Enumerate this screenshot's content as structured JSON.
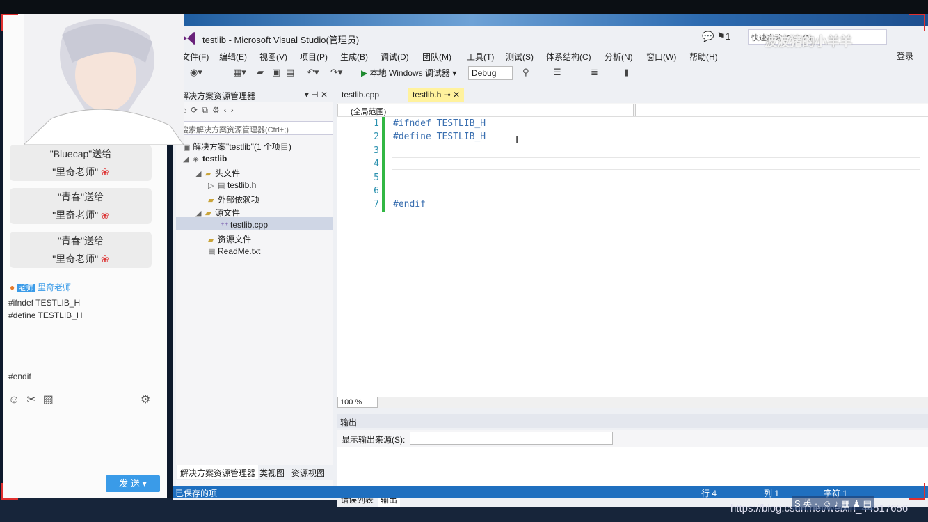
{
  "window": {
    "title": "testlib - Microsoft Visual Studio(管理员)",
    "quick_launch": "快速启动 (Ctrl+Q)",
    "watermark": "波波猪的小羊羊",
    "login": "登录",
    "flag_count": "1"
  },
  "menu": [
    "文件(F)",
    "编辑(E)",
    "视图(V)",
    "项目(P)",
    "生成(B)",
    "调试(D)",
    "团队(M)",
    "工具(T)",
    "测试(S)",
    "体系结构(C)",
    "分析(N)",
    "窗口(W)",
    "帮助(H)"
  ],
  "toolbar": {
    "run_label": "本地 Windows 调试器",
    "config": "Debug"
  },
  "solution_explorer": {
    "title": "解决方案资源管理器",
    "search_placeholder": "搜索解决方案资源管理器(Ctrl+;)",
    "solution": "解决方案\"testlib\"(1 个项目)",
    "project": "testlib",
    "items": {
      "headers": "头文件",
      "header_file": "testlib.h",
      "external": "外部依赖项",
      "sources": "源文件",
      "source_file": "testlib.cpp",
      "resources": "资源文件",
      "readme": "ReadMe.txt"
    },
    "tabs": [
      "解决方案资源管理器",
      "类视图",
      "资源视图"
    ]
  },
  "editor": {
    "tabs": [
      "testlib.cpp",
      "testlib.h"
    ],
    "scope": "(全局范围)",
    "lines": [
      {
        "n": "1",
        "text": "#ifndef TESTLIB_H"
      },
      {
        "n": "2",
        "text": "#define TESTLIB_H"
      },
      {
        "n": "3",
        "text": ""
      },
      {
        "n": "4",
        "text": ""
      },
      {
        "n": "5",
        "text": ""
      },
      {
        "n": "6",
        "text": ""
      },
      {
        "n": "7",
        "text": "#endif"
      }
    ],
    "zoom": "100 %"
  },
  "output": {
    "title": "输出",
    "source_label": "显示输出来源(S):",
    "tabs": [
      "错误列表",
      "输出"
    ]
  },
  "statusbar": {
    "text": "已保存的项",
    "line": "行 4",
    "col": "列 1",
    "char": "字符 1"
  },
  "stream_panel": {
    "gifts": [
      {
        "line1": "\"Bluecap\"送给",
        "line2": "\"里奇老师\""
      },
      {
        "line1": "\"青春\"送给",
        "line2": "\"里奇老师\""
      },
      {
        "line1": "\"青春\"送给",
        "line2": "\"里奇老师\""
      }
    ],
    "teacher_badge": "老师",
    "teacher_name": "里奇老师",
    "chat": [
      "#ifndef TESTLIB_H",
      "#define TESTLIB_H",
      "#endif"
    ],
    "send": "发 送"
  },
  "footer": {
    "csdn": "https://blog.csdn.net/weixin_44517656",
    "ime": "S 英 ·, ☺ ♪ ▦ ♟ ▤"
  }
}
